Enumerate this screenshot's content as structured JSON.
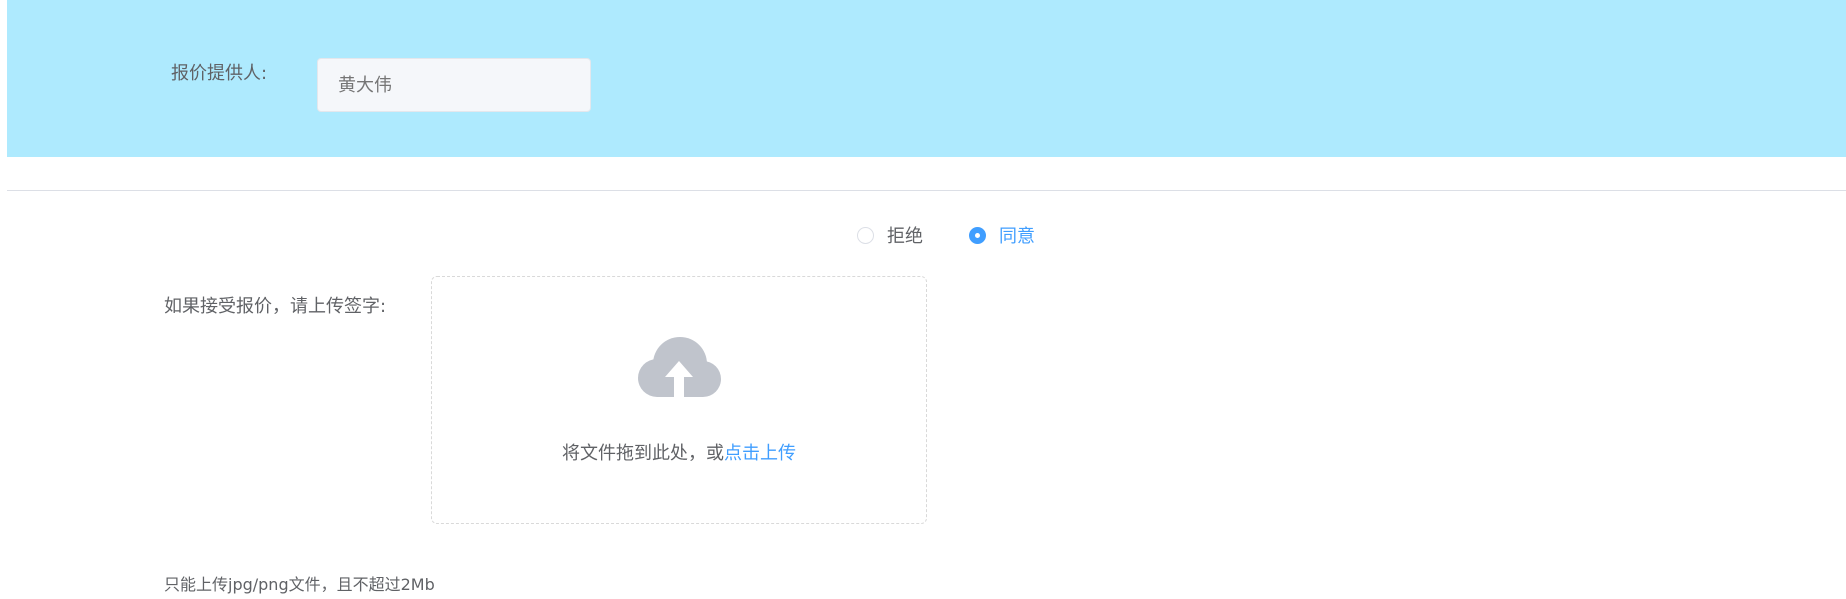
{
  "provider": {
    "label": "报价提供人:",
    "value": "黄大伟"
  },
  "decision": {
    "options": [
      {
        "label": "拒绝",
        "checked": false
      },
      {
        "label": "同意",
        "checked": true
      }
    ],
    "accent_color": "#409eff"
  },
  "signature": {
    "label": "如果接受报价，请上传签字:",
    "upload_icon": "cloud-upload-icon",
    "drop_text": "将文件拖到此处，或",
    "click_text": "点击上传"
  },
  "tip": "只能上传jpg/png文件，且不超过2Mb",
  "colors": {
    "header_band": "#aeeafe",
    "link": "#409eff"
  }
}
